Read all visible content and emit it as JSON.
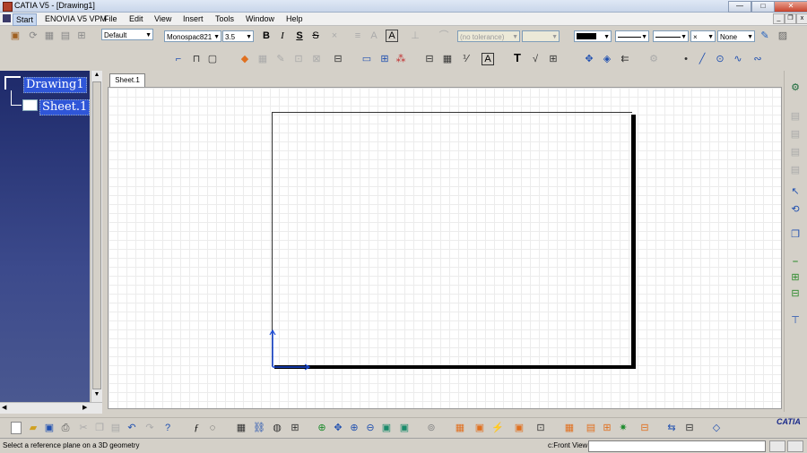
{
  "window": {
    "title": "CATIA V5 - [Drawing1]",
    "min": "—",
    "max": "□",
    "close": "✕"
  },
  "menubar": {
    "items": [
      "Start",
      "ENOVIA V5 VPM",
      "File",
      "Edit",
      "View",
      "Insert",
      "Tools",
      "Window",
      "Help"
    ],
    "sys_min": "_",
    "sys_restore": "❐",
    "sys_close": "x"
  },
  "toolbar": {
    "style_value": "Default",
    "font_value": "Monospac821",
    "size_value": "3.5",
    "bold": "B",
    "italic": "I",
    "underline": "S",
    "strike": "S",
    "tolerance_value": "(no tolerance)",
    "line_pattern_value": "None",
    "text_tool": "T"
  },
  "tree": {
    "root": "Drawing1",
    "child": "Sheet.1"
  },
  "sheet_tab": "Sheet.1",
  "status": {
    "message": "Select a reference plane on a 3D geometry",
    "view_label": "c:Front View"
  },
  "brand": "CATIA"
}
